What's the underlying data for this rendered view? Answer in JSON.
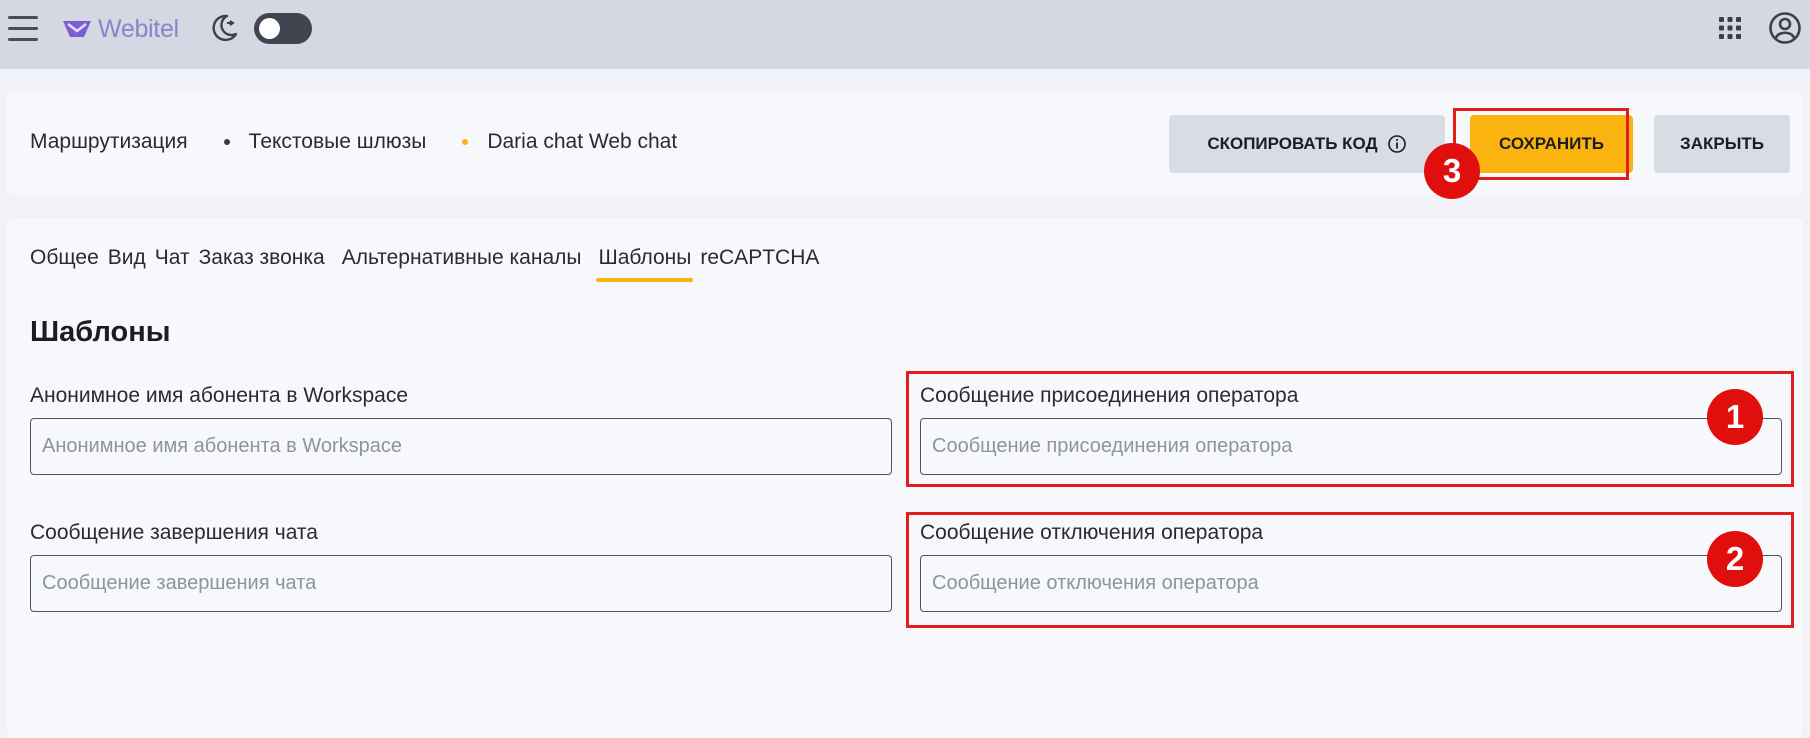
{
  "topbar": {
    "logo_text": "Webitel",
    "menu_icon": "hamburger-menu-icon",
    "theme_icon": "moon-icon",
    "apps_icon": "apps-grid-icon",
    "account_icon": "account-circle-icon"
  },
  "breadcrumb": {
    "items": [
      "Маршрутизация",
      "Текстовые шлюзы",
      "Daria chat Web chat"
    ]
  },
  "actions": {
    "copy_label": "СКОПИРОВАТЬ КОД",
    "save_label": "СОХРАНИТЬ",
    "close_label": "ЗАКРЫТЬ"
  },
  "tabs": [
    {
      "label": "Общее",
      "active": false
    },
    {
      "label": "Вид",
      "active": false
    },
    {
      "label": "Чат",
      "active": false
    },
    {
      "label": "Заказ звонка",
      "active": false
    },
    {
      "label": "Альтернативные каналы",
      "active": false
    },
    {
      "label": "Шаблоны",
      "active": true
    },
    {
      "label": "reCAPTCHA",
      "active": false
    }
  ],
  "section_title": "Шаблоны",
  "fields": {
    "anon_name": {
      "label": "Анонимное имя абонента в Workspace",
      "placeholder": "Анонимное имя абонента в Workspace",
      "value": ""
    },
    "operator_join": {
      "label": "Сообщение присоединения оператора",
      "placeholder": "Сообщение присоединения оператора",
      "value": ""
    },
    "chat_end": {
      "label": "Сообщение завершения чата",
      "placeholder": "Сообщение завершения чата",
      "value": ""
    },
    "operator_leave": {
      "label": "Сообщение отключения оператора",
      "placeholder": "Сообщение отключения оператора",
      "value": ""
    }
  },
  "annotations": [
    "1",
    "2",
    "3"
  ],
  "colors": {
    "accent": "#fbb40f",
    "topbar": "#d3d8e3",
    "highlight": "#e11d1d",
    "breadcrumb_dot_1": "#3a3d46",
    "breadcrumb_dot_2": "#fbb40f"
  }
}
